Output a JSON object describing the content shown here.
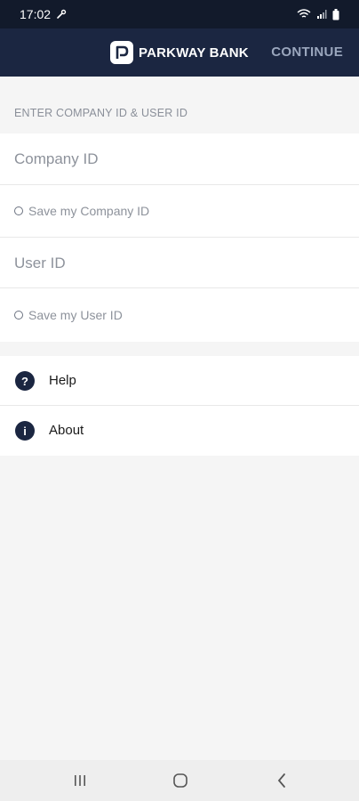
{
  "status_bar": {
    "time": "17:02"
  },
  "header": {
    "brand_name": "PARKWAY BANK",
    "continue_label": "CONTINUE"
  },
  "form": {
    "section_title": "ENTER COMPANY ID & USER ID",
    "company_id_placeholder": "Company ID",
    "save_company_label": "Save my Company ID",
    "user_id_placeholder": "User ID",
    "save_user_label": "Save my User ID"
  },
  "menu": {
    "items": [
      {
        "label": "Help",
        "icon": "help-icon"
      },
      {
        "label": "About",
        "icon": "info-icon"
      }
    ]
  },
  "colors": {
    "header_bg": "#1b2641",
    "continue": "#9aa6bd",
    "icon_bg": "#1b2641"
  }
}
